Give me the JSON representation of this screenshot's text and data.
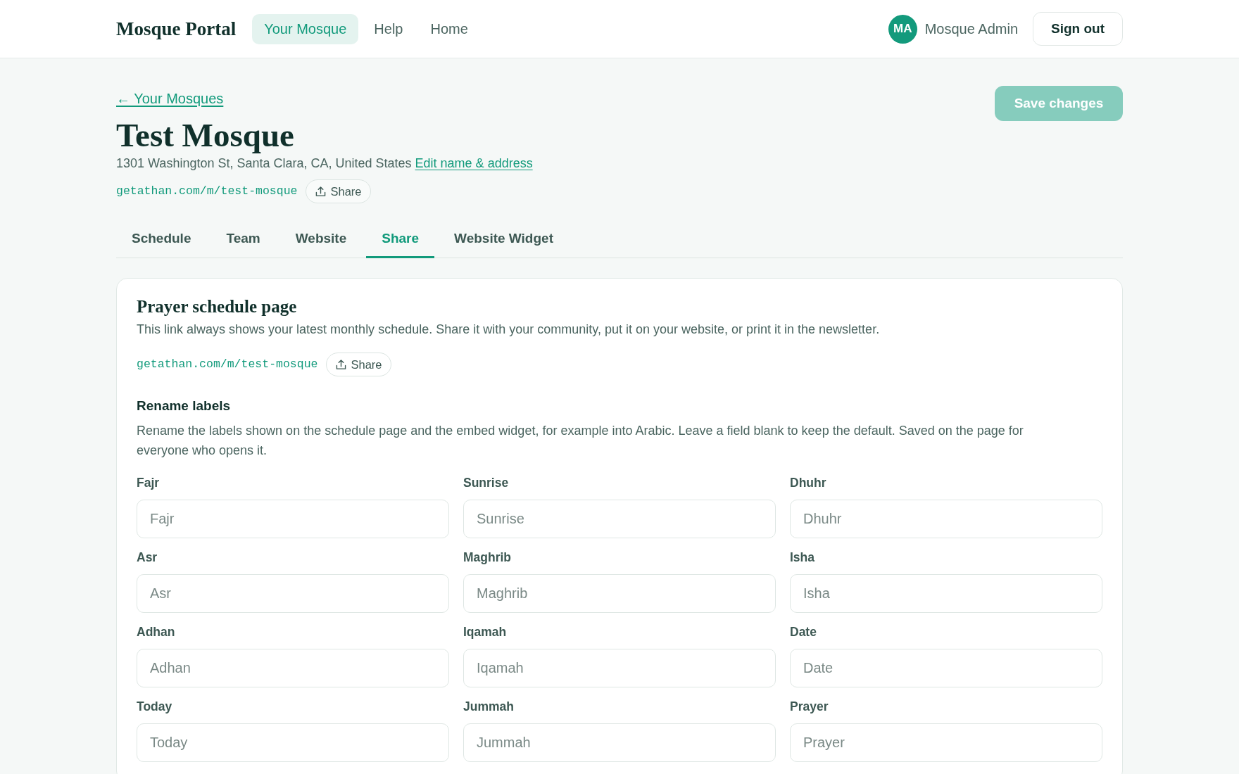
{
  "header": {
    "logo": "Mosque Portal",
    "nav": [
      {
        "label": "Your Mosque",
        "selected": true
      },
      {
        "label": "Help",
        "selected": false
      },
      {
        "label": "Home",
        "selected": false
      }
    ],
    "user": {
      "initials": "MA",
      "name": "Mosque Admin"
    },
    "sign_out_button": "Sign out"
  },
  "page": {
    "back_link": "← Your Mosques",
    "save_button": {
      "label": "Save changes",
      "disabled": true
    },
    "title": "Test Mosque",
    "address": "1301 Washington St, Santa Clara, CA, United States",
    "edit_link": "Edit name & address",
    "public_link": "getathan.com/m/test-mosque",
    "share_button": "Share"
  },
  "tabs": [
    {
      "label": "Schedule",
      "selected": false
    },
    {
      "label": "Team",
      "selected": false
    },
    {
      "label": "Website",
      "selected": false
    },
    {
      "label": "Share",
      "selected": true
    },
    {
      "label": "Website Widget",
      "selected": false
    }
  ],
  "share_card": {
    "title": "Prayer schedule page",
    "description": "This link always shows your latest monthly schedule. Share it with your community, put it on your website, or print it in the newsletter.",
    "link": "getathan.com/m/test-mosque",
    "share_button": "Share",
    "rename_labels": {
      "heading": "Rename labels",
      "description": "Rename the labels shown on the schedule page and the embed widget, for example into Arabic. Leave a field blank to keep the default. Saved on the page for everyone who opens it.",
      "fields": [
        {
          "label": "Fajr",
          "placeholder": "Fajr"
        },
        {
          "label": "Sunrise",
          "placeholder": "Sunrise"
        },
        {
          "label": "Dhuhr",
          "placeholder": "Dhuhr"
        },
        {
          "label": "Asr",
          "placeholder": "Asr"
        },
        {
          "label": "Maghrib",
          "placeholder": "Maghrib"
        },
        {
          "label": "Isha",
          "placeholder": "Isha"
        },
        {
          "label": "Adhan",
          "placeholder": "Adhan"
        },
        {
          "label": "Iqamah",
          "placeholder": "Iqamah"
        },
        {
          "label": "Date",
          "placeholder": "Date"
        },
        {
          "label": "Today",
          "placeholder": "Today"
        },
        {
          "label": "Jummah",
          "placeholder": "Jummah"
        },
        {
          "label": "Prayer",
          "placeholder": "Prayer"
        }
      ]
    }
  }
}
